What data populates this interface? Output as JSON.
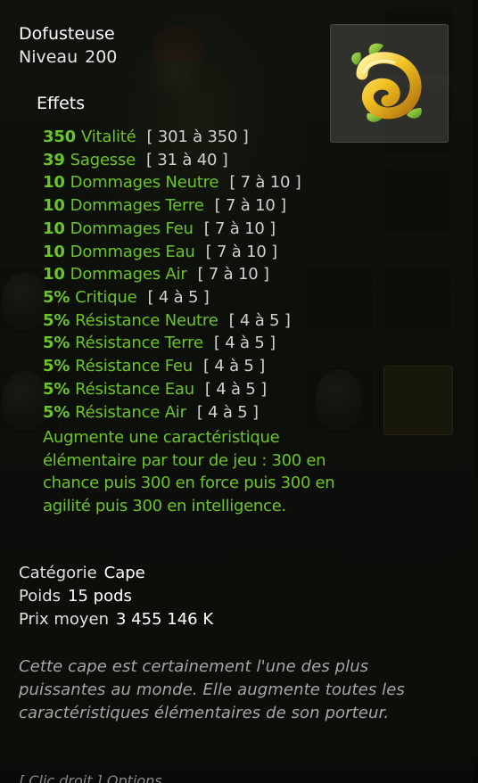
{
  "item": {
    "name": "Dofusteuse",
    "level_label": "Niveau",
    "level": "200",
    "icon": "dofus-egg-icon"
  },
  "effects_title": "Effets",
  "effects": [
    {
      "value": "350",
      "stat": "Vitalité",
      "range": "[ 301 à 350 ]"
    },
    {
      "value": "39",
      "stat": "Sagesse",
      "range": "[ 31 à 40 ]"
    },
    {
      "value": "10",
      "stat": "Dommages Neutre",
      "range": "[ 7 à 10 ]"
    },
    {
      "value": "10",
      "stat": "Dommages Terre",
      "range": "[ 7 à 10 ]"
    },
    {
      "value": "10",
      "stat": "Dommages Feu",
      "range": "[ 7 à 10 ]"
    },
    {
      "value": "10",
      "stat": "Dommages Eau",
      "range": "[ 7 à 10 ]"
    },
    {
      "value": "10",
      "stat": "Dommages Air",
      "range": "[ 7 à 10 ]"
    },
    {
      "value": "5%",
      "stat": "Critique",
      "range": "[ 4 à 5 ]"
    },
    {
      "value": "5%",
      "stat": "Résistance Neutre",
      "range": "[ 4 à 5 ]"
    },
    {
      "value": "5%",
      "stat": "Résistance Terre",
      "range": "[ 4 à 5 ]"
    },
    {
      "value": "5%",
      "stat": "Résistance Feu",
      "range": "[ 4 à 5 ]"
    },
    {
      "value": "5%",
      "stat": "Résistance Eau",
      "range": "[ 4 à 5 ]"
    },
    {
      "value": "5%",
      "stat": "Résistance Air",
      "range": "[ 4 à 5 ]"
    }
  ],
  "special_effect": "Augmente une caractéristique élémentaire par tour de jeu : 300 en chance puis 300 en force puis 300 en agilité puis 300 en intelligence.",
  "category": {
    "label": "Catégorie",
    "value": "Cape"
  },
  "weight": {
    "label": "Poids",
    "value": "15 pods"
  },
  "price": {
    "label": "Prix moyen",
    "value": "3 455 146 K"
  },
  "flavor_text": "Cette cape est certainement l'une des plus puissantes au monde. Elle augmente toutes les caractéristiques élémentaires de son porteur.",
  "hint": "[ Clic droit ] Options",
  "colors": {
    "effect_green": "#6cc42c",
    "range_gray": "#d0d0d0",
    "flavor_gray": "#a6a6a6",
    "background": "#161912"
  }
}
